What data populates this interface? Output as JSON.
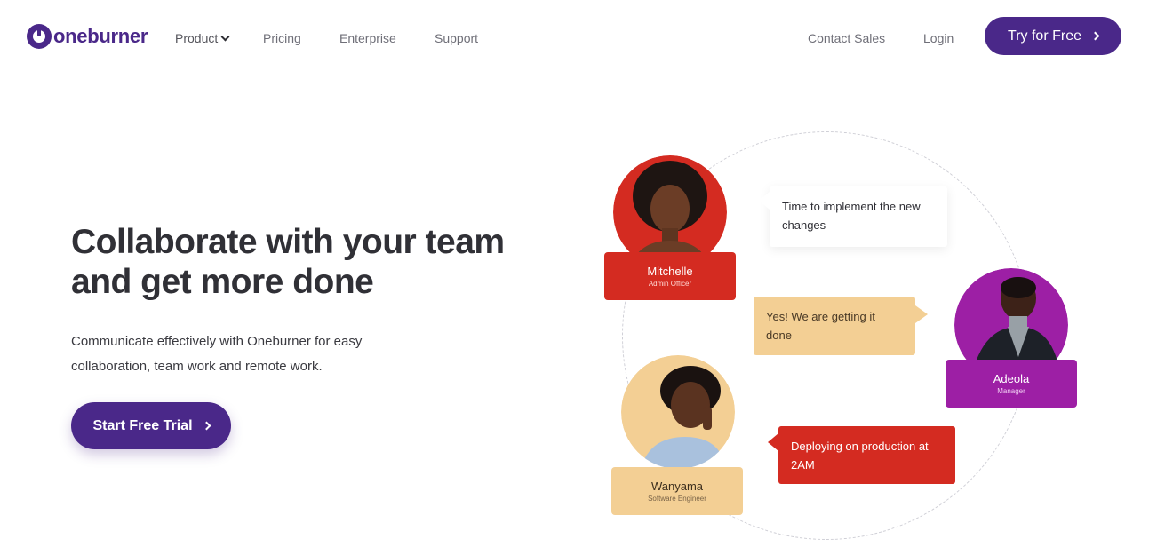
{
  "nav": {
    "logo_text": "oneburner",
    "links": {
      "product": "Product",
      "pricing": "Pricing",
      "enterprise": "Enterprise",
      "support": "Support",
      "contact_sales": "Contact Sales",
      "login": "Login"
    },
    "cta_label": "Try for Free"
  },
  "hero": {
    "headline": "Collaborate with your team and get more done",
    "subtext": "Communicate effectively with Oneburner for easy collaboration, team work and remote work.",
    "cta_label": "Start Free Trial"
  },
  "illustration": {
    "people": [
      {
        "name": "Mitchelle",
        "role": "Admin Officer",
        "color": "#d42b21"
      },
      {
        "name": "Adeola",
        "role": "Manager",
        "color": "#9d1fa5"
      },
      {
        "name": "Wanyama",
        "role": "Software Engineer",
        "color": "#f3cf94"
      }
    ],
    "messages": [
      "Time to implement the new changes",
      "Yes! We are getting it done",
      "Deploying on production at 2AM"
    ]
  },
  "colors": {
    "brand": "#4a2889",
    "red": "#d42b21",
    "purple": "#9d1fa5",
    "sand": "#f3cf94"
  },
  "icons": {
    "dropdown": "chevron-down-icon",
    "cta_arrow": "chevron-right-icon",
    "logo": "power-icon"
  }
}
